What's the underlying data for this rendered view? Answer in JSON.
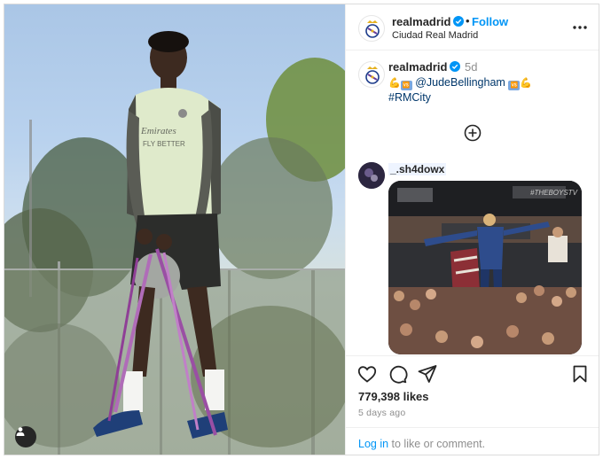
{
  "post": {
    "username": "realmadrid",
    "follow_label": "Follow",
    "dot": "•",
    "location": "Ciudad Real Madrid",
    "more_icon": "more-horizontal-icon"
  },
  "caption": {
    "username": "realmadrid",
    "time": "5d",
    "mention": "@JudeBellingham",
    "hashtag": "#RMCity",
    "emoji_left": "💪",
    "emoji_right": "💪",
    "emoji_box": "🆚"
  },
  "comment": {
    "username": "_.sh4dowx",
    "image_watermark": "#THEBOYSTV"
  },
  "photo": {
    "shirt_text_line1": "Emirates",
    "shirt_text_line2": "FLY BETTER"
  },
  "actions": {
    "likes": "779,398 likes",
    "time_ago": "5 days ago",
    "login_link": "Log in",
    "login_rest": " to like or comment."
  },
  "colors": {
    "link_blue": "#0095f6",
    "text": "#262626",
    "muted": "#8e8e8e",
    "verified": "#0095f6"
  }
}
